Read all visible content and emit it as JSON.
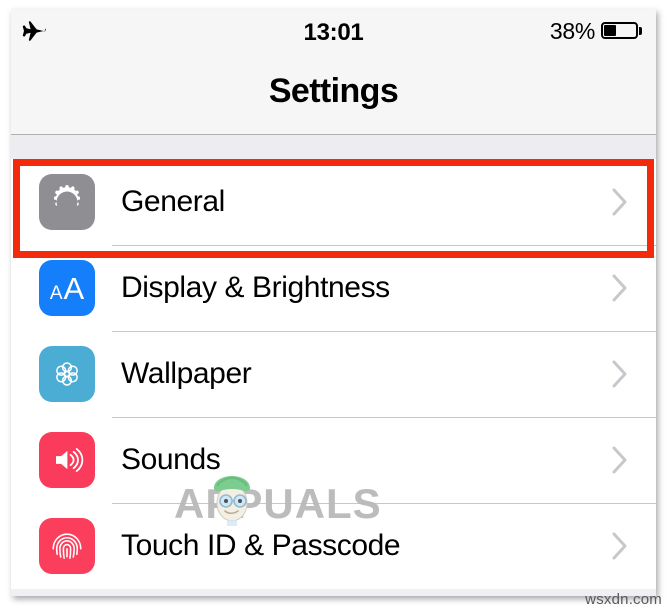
{
  "status_bar": {
    "airplane_icon": "airplane-mode-icon",
    "time": "13:01",
    "battery_percent_label": "38%",
    "battery_level": 38,
    "battery_icon": "battery-icon"
  },
  "nav": {
    "title": "Settings"
  },
  "list": {
    "rows": [
      {
        "label": "General",
        "icon": "gear-icon",
        "icon_color": "#8e8e93",
        "chevron": "chevron-right-icon",
        "highlighted": true
      },
      {
        "label": "Display & Brightness",
        "icon": "text-size-aa-icon",
        "icon_color": "#147efb",
        "chevron": "chevron-right-icon",
        "highlighted": false
      },
      {
        "label": "Wallpaper",
        "icon": "flower-pattern-icon",
        "icon_color": "#4cadd4",
        "chevron": "chevron-right-icon",
        "highlighted": false
      },
      {
        "label": "Sounds",
        "icon": "speaker-volume-icon",
        "icon_color": "#fa3b5c",
        "chevron": "chevron-right-icon",
        "highlighted": false
      },
      {
        "label": "Touch ID & Passcode",
        "icon": "fingerprint-icon",
        "icon_color": "#fa3e5c",
        "chevron": "chevron-right-icon",
        "highlighted": false
      }
    ]
  },
  "annotation": {
    "highlight_color": "#f42a0c",
    "target_row": "General"
  },
  "watermark": {
    "brand": "PUALS",
    "brand_full": "APPUALS",
    "color": "#b9b9b9"
  },
  "footer": {
    "site": "wsxdn.com"
  }
}
